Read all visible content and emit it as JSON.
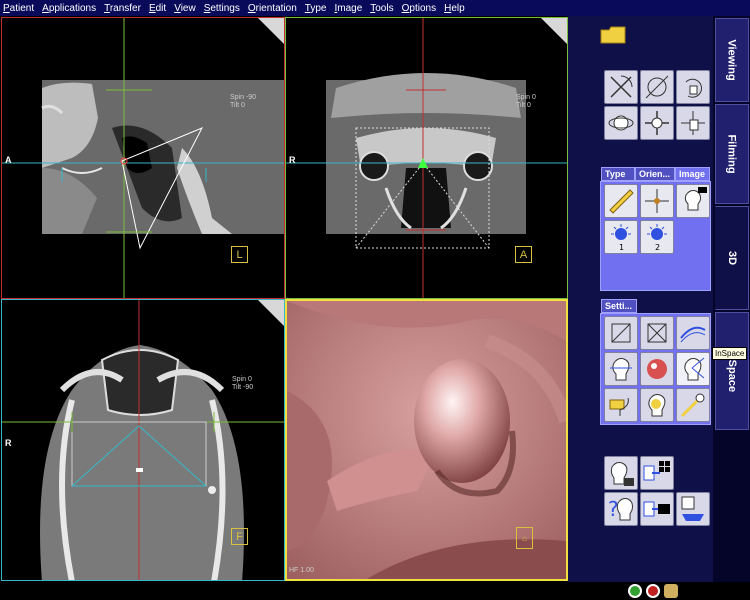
{
  "menu": [
    "Patient",
    "Applications",
    "Transfer",
    "Edit",
    "View",
    "Settings",
    "Orientation",
    "Type",
    "Image",
    "Tools",
    "Options",
    "Help"
  ],
  "viewports": {
    "sagittal": {
      "left_label": "A",
      "info1": "Spin -90",
      "info2": "Tilt  0",
      "corner": "L"
    },
    "coronal": {
      "left_label": "R",
      "info1": "Spin  0",
      "info2": "Tilt  0",
      "corner": "A"
    },
    "axial": {
      "left_label": "R",
      "info1": "Spin  0",
      "info2": "Tilt -90",
      "corner": "F"
    },
    "render3d": {
      "info": "HF 1.00"
    }
  },
  "side_tabs": [
    "Viewing",
    "Filming",
    "3D",
    "InSpace"
  ],
  "groups": {
    "type_tabs": [
      "Type",
      "Orien...",
      "Image"
    ],
    "settings_tab": "Setti..."
  },
  "tooltip": "InSpace",
  "colors": {
    "sagittal_border": "#c03030",
    "coronal_border": "#7cbc3c",
    "axial_border": "#36b8c8",
    "render_border": "#f0e040",
    "panel_bg": "#101048",
    "group_bg": "#7070f0"
  }
}
